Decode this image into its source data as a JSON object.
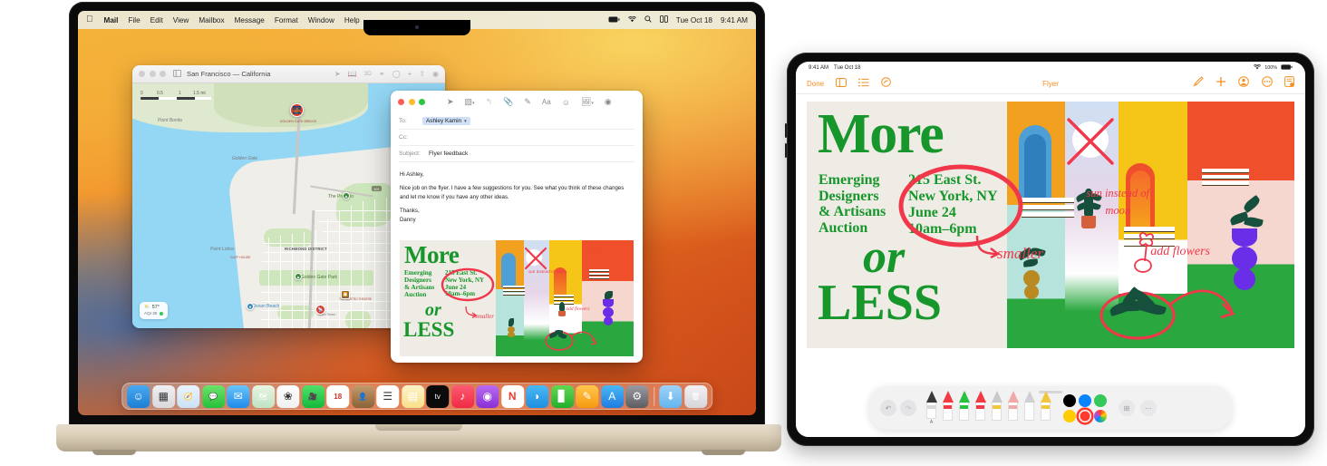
{
  "macbook": {
    "menubar": {
      "apple_icon": "apple-icon",
      "items": [
        "Mail",
        "File",
        "Edit",
        "View",
        "Mailbox",
        "Message",
        "Format",
        "Window",
        "Help"
      ],
      "status": {
        "battery_icon": "battery-icon",
        "wifi_icon": "wifi-icon",
        "search_icon": "search-icon",
        "control_center_icon": "control-center-icon",
        "date": "Tue Oct 18",
        "time": "9:41 AM"
      }
    },
    "maps_window": {
      "title": "San Francisco — California",
      "sidebar_icon": "sidebar-icon",
      "toolbar_icons": [
        "location-arrow-icon",
        "guides-book-icon",
        "3d-icon",
        "look-around-icon",
        "recents-clock-icon",
        "add-icon",
        "share-icon",
        "account-icon"
      ],
      "toolbar_3d_label": "3D",
      "scale": {
        "ticks": [
          "0",
          "0.5",
          "1",
          "1.5 mi"
        ]
      },
      "weather": {
        "temp": "57°",
        "aqi_label": "AQI 30"
      },
      "labels": [
        "Point Bonita",
        "Golden Gate",
        "GOLDEN GATE BRIDGE",
        "The Presidio",
        "101",
        "LOMBARD",
        "Point Lobos",
        "CLIFF HOUSE",
        "RICHMOND DISTRICT",
        "Golden Gate Park",
        "Ocean Beach",
        "Sutro Tower",
        "THE CASTRO THEATRE",
        "Sa"
      ]
    },
    "mail_window": {
      "toolbar_icons": [
        "send-icon",
        "stationery-icon",
        "reply-icon",
        "attach-icon",
        "markup-icon",
        "format-icon",
        "emoji-icon",
        "photo-browser-icon",
        "signature-icon"
      ],
      "format_label": "Aa",
      "fields": {
        "to_label": "To:",
        "to_value": "Ashley Kamin",
        "cc_label": "Cc:",
        "cc_value": "",
        "subject_label": "Subject:",
        "subject_value": "Flyer feedback"
      },
      "body": {
        "greeting": "Hi Ashley,",
        "paragraph": "Nice job on the flyer. I have a few suggestions for you. See what you think of these changes and let me know if you have any other ideas.",
        "signoff": "Thanks,",
        "name": "Danny"
      }
    },
    "dock": {
      "apps": [
        {
          "name": "finder",
          "glyph": "☺",
          "bg": "linear-gradient(180deg,#4aa8f0,#1b7fd4)",
          "running": true
        },
        {
          "name": "launchpad",
          "glyph": "▦",
          "bg": "linear-gradient(180deg,#f0f0f2,#d9d9de)",
          "running": false
        },
        {
          "name": "safari",
          "glyph": "🧭",
          "bg": "linear-gradient(180deg,#eaf4fd,#c9e1f6)",
          "running": false
        },
        {
          "name": "messages",
          "glyph": "💬",
          "bg": "linear-gradient(180deg,#6ce36a,#27c03a)",
          "running": false
        },
        {
          "name": "mail",
          "glyph": "✉",
          "bg": "linear-gradient(180deg,#69c4f8,#1f8bea)",
          "running": true
        },
        {
          "name": "maps",
          "glyph": "🗺",
          "bg": "linear-gradient(180deg,#e9f5e2,#bfe3c4)",
          "running": true
        },
        {
          "name": "photos",
          "glyph": "❀",
          "bg": "linear-gradient(180deg,#ffffff,#f0f0f2)",
          "running": false
        },
        {
          "name": "facetime",
          "glyph": "🎥",
          "bg": "linear-gradient(180deg,#52e06a,#12b93c)",
          "running": false
        },
        {
          "name": "calendar",
          "glyph": "18",
          "bg": "#ffffff",
          "running": false
        },
        {
          "name": "contacts",
          "glyph": "👤",
          "bg": "linear-gradient(180deg,#c39a6c,#8a6239)",
          "running": false
        },
        {
          "name": "reminders",
          "glyph": "☰",
          "bg": "#ffffff",
          "running": false
        },
        {
          "name": "notes",
          "glyph": "▤",
          "bg": "linear-gradient(180deg,#fdf3c8,#f7e08a)",
          "running": false
        },
        {
          "name": "apple-tv",
          "glyph": "tv",
          "bg": "#0b0b0c",
          "running": false
        },
        {
          "name": "music",
          "glyph": "♪",
          "bg": "linear-gradient(180deg,#fb5b70,#f02a46)",
          "running": false
        },
        {
          "name": "podcasts",
          "glyph": "◉",
          "bg": "linear-gradient(180deg,#b96bf0,#8930d6)",
          "running": false
        },
        {
          "name": "news",
          "glyph": "N",
          "bg": "#ffffff",
          "running": false
        },
        {
          "name": "keynote",
          "glyph": "◗",
          "bg": "linear-gradient(180deg,#4bb8f5,#1f8fe0)",
          "running": false
        },
        {
          "name": "numbers",
          "glyph": "▊",
          "bg": "linear-gradient(180deg,#63d852,#23ae2e)",
          "running": false
        },
        {
          "name": "pages",
          "glyph": "✎",
          "bg": "linear-gradient(180deg,#ffc64d,#f59a10)",
          "running": false
        },
        {
          "name": "app-store",
          "glyph": "A",
          "bg": "linear-gradient(180deg,#4bb8f5,#1f7ce0)",
          "running": false
        },
        {
          "name": "system-settings",
          "glyph": "⚙",
          "bg": "linear-gradient(180deg,#9a9aa0,#5c5c63)",
          "running": false
        }
      ],
      "tail": [
        {
          "name": "downloads-folder",
          "glyph": "⬇",
          "bg": "linear-gradient(180deg,#9fd3f6,#64b4ef)"
        },
        {
          "name": "trash",
          "glyph": "🗑",
          "bg": "linear-gradient(180deg,#f2f2f4,#d6d6da)"
        }
      ]
    }
  },
  "ipad": {
    "status": {
      "time": "9:41 AM",
      "date": "Tue Oct 18",
      "wifi_icon": "wifi-icon",
      "battery_label": "100%",
      "battery_icon": "battery-icon"
    },
    "toolbar": {
      "done_label": "Done",
      "sidebar_icon": "sidebar-icon",
      "list_icon": "list-icon",
      "markup-tools_icon": "markup-tools-icon",
      "title": "Flyer",
      "right_icons": [
        "markup-pen-icon",
        "add-icon",
        "share-person-icon",
        "more-icon",
        "document-icon"
      ]
    },
    "markup_bar": {
      "undo_icon": "undo-icon",
      "redo_icon": "redo-icon",
      "tools": [
        {
          "name": "fountain-pen-tool",
          "tip": "#3a3a3c",
          "band": "#d9d9dc",
          "label": "A"
        },
        {
          "name": "pen-tool",
          "tip": "#ef3b41",
          "band": "#ef3b41",
          "label": ""
        },
        {
          "name": "highlighter-green-tool",
          "tip": "#27c23f",
          "band": "#27c23f",
          "label": ""
        },
        {
          "name": "marker-red-tool",
          "tip": "#ef3b41",
          "band": "#ef3b41",
          "label": ""
        },
        {
          "name": "paintbrush-tool",
          "tip": "#c9c9cd",
          "band": "#f2c53d",
          "label": ""
        },
        {
          "name": "eraser-tool",
          "tip": "#f0a8a8",
          "band": "#f0a8a8",
          "label": ""
        },
        {
          "name": "lasso-tool",
          "tip": "#d0d0d4",
          "band": "#ffffff",
          "label": ""
        },
        {
          "name": "highlighter-yellow-tool",
          "tip": "#f2c53d",
          "band": "#f2c53d",
          "label": ""
        }
      ],
      "colors": [
        {
          "name": "black-swatch",
          "hex": "#000000",
          "selected": false
        },
        {
          "name": "blue-swatch",
          "hex": "#0a84ff",
          "selected": false
        },
        {
          "name": "green-swatch",
          "hex": "#34c759",
          "selected": false
        },
        {
          "name": "yellow-swatch",
          "hex": "#ffcc00",
          "selected": false
        },
        {
          "name": "red-swatch",
          "hex": "#ff3b30",
          "selected": true
        },
        {
          "name": "color-wheel-swatch",
          "hex": "conic",
          "selected": false
        }
      ],
      "add_icon": "add-item-icon",
      "more_icon": "more-icon"
    }
  },
  "flyer": {
    "headline_1": "More",
    "headline_2": "or",
    "headline_3": "LESS",
    "subtitle_lines": [
      "Emerging",
      "Designers",
      "& Artisans",
      "Auction"
    ],
    "address_lines": [
      "215 East St.",
      "New York, NY",
      "June 24",
      "10am–6pm"
    ],
    "annotations": [
      {
        "name": "circle-address-annotation",
        "text": ""
      },
      {
        "name": "smaller-annotation",
        "text": "smaller"
      },
      {
        "name": "sun-instead-of-moon-annotation",
        "text": "sun instead of moon"
      },
      {
        "name": "add-flowers-annotation",
        "text": "add flowers"
      },
      {
        "name": "x-over-moon-annotation",
        "text": ""
      },
      {
        "name": "move-plant-arrow-annotation",
        "text": ""
      }
    ],
    "colors": {
      "green": "#17962c",
      "red_ink": "#f0384a",
      "paper": "#eeece4",
      "orange": "#f2a01f",
      "yellow": "#f5c518",
      "blue": "#4e9fd6",
      "teal": "#b6e4dc",
      "lilac": "#e6d6e8",
      "grass": "#2aa83f",
      "purple": "#6a2ee8",
      "tomato": "#ef4f2b"
    }
  }
}
